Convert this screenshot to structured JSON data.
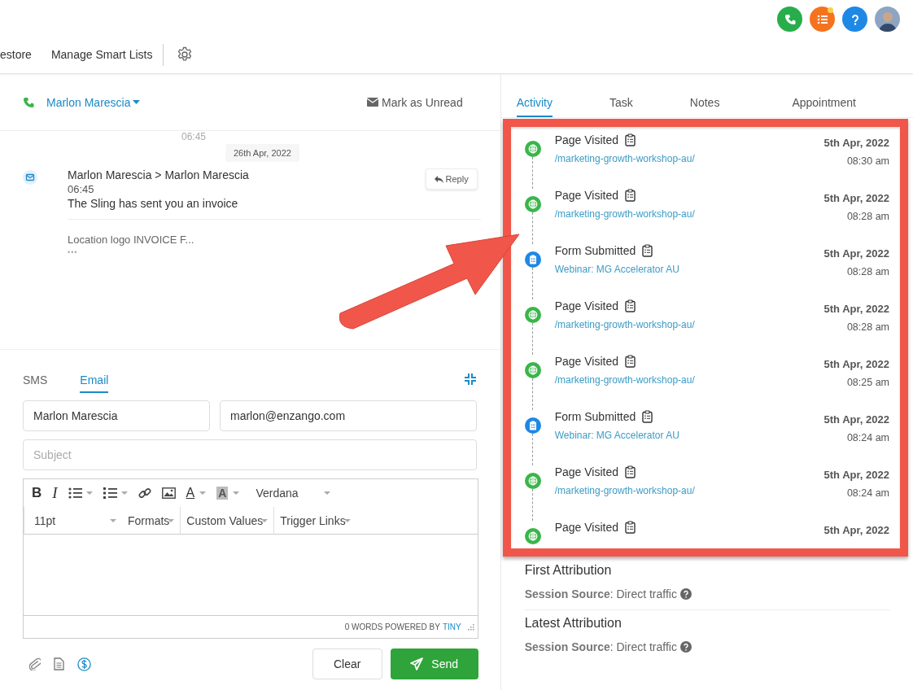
{
  "top_icons": [
    {
      "kind": "phone",
      "notification": false
    },
    {
      "kind": "list",
      "notification": true
    },
    {
      "kind": "help",
      "notification": false
    },
    {
      "kind": "avatar",
      "notification": false
    }
  ],
  "nav": {
    "items": [
      "estore",
      "Manage Smart Lists"
    ]
  },
  "conversation": {
    "contact": "Marlon Marescia",
    "mark_unread": "Mark as Unread",
    "time_top": "06:45",
    "date_chip": "26th Apr, 2022",
    "message": {
      "header": "Marlon Marescia > Marlon Marescia",
      "time": "06:45",
      "subject": "The Sling has sent you an invoice",
      "preview": "Location logo INVOICE F...",
      "more": "•••",
      "reply": "Reply"
    }
  },
  "composer": {
    "tabs": [
      {
        "label": "SMS",
        "selected": false
      },
      {
        "label": "Email",
        "selected": true
      }
    ],
    "name_value": "Marlon Marescia",
    "email_value": "marlon@enzango.com",
    "subject_placeholder": "Subject",
    "toolbar": [
      {
        "kind": "bold",
        "label": "B"
      },
      {
        "kind": "italic",
        "label": "I"
      },
      {
        "kind": "bullets"
      },
      {
        "kind": "numbers"
      },
      {
        "kind": "link"
      },
      {
        "kind": "image"
      },
      {
        "kind": "text-color",
        "label": "A"
      },
      {
        "kind": "bg-color",
        "label": "A"
      }
    ],
    "font": "Verdana",
    "size": "11pt",
    "menus": [
      "Formats",
      "Custom Values",
      "Trigger Links"
    ],
    "status": "0 WORDS POWERED BY",
    "status_link": "TINY",
    "clear": "Clear",
    "send": "Send"
  },
  "activity": {
    "tabs": [
      {
        "label": "Activity",
        "selected": true
      },
      {
        "label": "Task",
        "selected": false
      },
      {
        "label": "Notes",
        "selected": false
      },
      {
        "label": "Appointment",
        "selected": false
      }
    ],
    "items": [
      {
        "kind": "page",
        "title": "Page Visited",
        "link": "/marketing-growth-workshop-au/",
        "date": "5th Apr, 2022",
        "time": "08:30 am"
      },
      {
        "kind": "page",
        "title": "Page Visited",
        "link": "/marketing-growth-workshop-au/",
        "date": "5th Apr, 2022",
        "time": "08:28 am"
      },
      {
        "kind": "form",
        "title": "Form Submitted",
        "link": "Webinar: MG Accelerator AU",
        "date": "5th Apr, 2022",
        "time": "08:28 am"
      },
      {
        "kind": "page",
        "title": "Page Visited",
        "link": "/marketing-growth-workshop-au/",
        "date": "5th Apr, 2022",
        "time": "08:28 am"
      },
      {
        "kind": "page",
        "title": "Page Visited",
        "link": "/marketing-growth-workshop-au/",
        "date": "5th Apr, 2022",
        "time": "08:25 am"
      },
      {
        "kind": "form",
        "title": "Form Submitted",
        "link": "Webinar: MG Accelerator AU",
        "date": "5th Apr, 2022",
        "time": "08:24 am"
      },
      {
        "kind": "page",
        "title": "Page Visited",
        "link": "/marketing-growth-workshop-au/",
        "date": "5th Apr, 2022",
        "time": "08:24 am"
      },
      {
        "kind": "page",
        "title": "Page Visited",
        "date": "5th Apr, 2022"
      }
    ],
    "attribution": [
      {
        "title": "First Attribution",
        "line": "**Session Source**: Direct traffic"
      },
      {
        "title": "Latest Attribution",
        "line": "**Session Source**: Direct traffic"
      }
    ]
  }
}
